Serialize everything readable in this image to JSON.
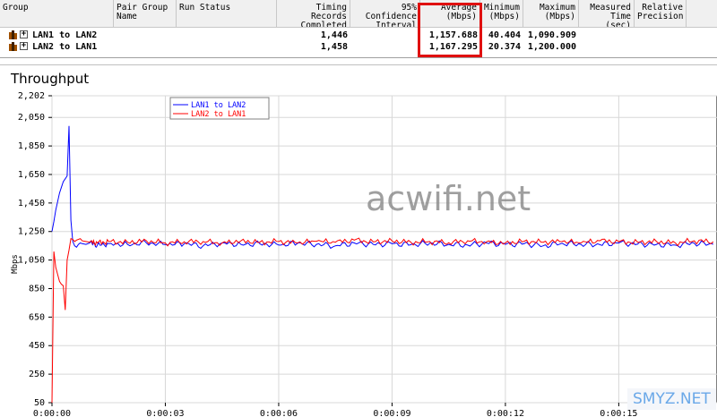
{
  "table": {
    "columns": [
      {
        "label": "Group",
        "align": "left"
      },
      {
        "label": "Pair Group\nName",
        "align": "left"
      },
      {
        "label": "Run Status",
        "align": "left"
      },
      {
        "label": "Timing Records\nCompleted",
        "align": "right"
      },
      {
        "label": "95% Confidence\nInterval",
        "align": "right"
      },
      {
        "label": "Average\n(Mbps)",
        "align": "right"
      },
      {
        "label": "Minimum\n(Mbps)",
        "align": "right"
      },
      {
        "label": "Maximum\n(Mbps)",
        "align": "right"
      },
      {
        "label": "Measured\nTime (sec)",
        "align": "right"
      },
      {
        "label": "Relative\nPrecision",
        "align": "right"
      }
    ],
    "rows": [
      {
        "group": "LAN1 to LAN2",
        "pair_group": "",
        "run_status": "",
        "timing_records": "1,446",
        "confidence": "",
        "average": "1,157.688",
        "minimum": "40.404",
        "maximum": "1,090.909",
        "measured_time": "",
        "precision": ""
      },
      {
        "group": "LAN2 to LAN1",
        "pair_group": "",
        "run_status": "",
        "timing_records": "1,458",
        "confidence": "",
        "average": "1,167.295",
        "minimum": "20.374",
        "maximum": "1,200.000",
        "measured_time": "",
        "precision": ""
      }
    ]
  },
  "graph": {
    "title": "Throughput",
    "watermark": "acwifi.net",
    "watermark2": "SMYZ.NET"
  },
  "chart_data": {
    "type": "line",
    "title": "Throughput",
    "xlabel": "",
    "ylabel": "Mbps",
    "ylim": [
      50,
      2202
    ],
    "xlim": [
      0,
      17.6
    ],
    "x_unit": "seconds (elapsed h:mm:ss)",
    "yticks": [
      "2,202",
      "2,050",
      "1,850",
      "1,650",
      "1,450",
      "1,250",
      "1,050",
      "850",
      "650",
      "450",
      "250",
      "50"
    ],
    "ytick_values": [
      2202,
      2050,
      1850,
      1650,
      1450,
      1250,
      1050,
      850,
      650,
      450,
      250,
      50
    ],
    "xticks": [
      "0:00:00",
      "0:00:03",
      "0:00:06",
      "0:00:09",
      "0:00:12",
      "0:00:15"
    ],
    "xtick_values": [
      0,
      3,
      6,
      9,
      12,
      15
    ],
    "grid": true,
    "legend_position": "top-left",
    "series": [
      {
        "name": "LAN1 to LAN2",
        "color": "#0000ff",
        "x": [
          0.0,
          0.05,
          0.1,
          0.15,
          0.2,
          0.25,
          0.3,
          0.35,
          0.4,
          0.45,
          0.5,
          0.55,
          0.6,
          0.65,
          0.7,
          0.75,
          0.8,
          0.9,
          1.0,
          1.2,
          1.5,
          2,
          2.5,
          3,
          3.5,
          4,
          4.5,
          5,
          5.5,
          6,
          6.5,
          7,
          7.5,
          8,
          8.5,
          9,
          9.5,
          10,
          10.5,
          11,
          11.5,
          12,
          12.5,
          13,
          13.5,
          14,
          14.5,
          15,
          15.5,
          16,
          16.5,
          17,
          17.5
        ],
        "y": [
          1250,
          1320,
          1400,
          1460,
          1520,
          1560,
          1600,
          1620,
          1640,
          1990,
          1330,
          1180,
          1150,
          1140,
          1160,
          1170,
          1165,
          1160,
          1170,
          1155,
          1165,
          1160,
          1170,
          1158,
          1165,
          1150,
          1170,
          1160,
          1165,
          1155,
          1168,
          1160,
          1150,
          1170,
          1160,
          1165,
          1158,
          1168,
          1160,
          1155,
          1170,
          1160,
          1165,
          1150,
          1168,
          1160,
          1158,
          1170,
          1162,
          1160,
          1155,
          1168,
          1160
        ]
      },
      {
        "name": "LAN2 to LAN1",
        "color": "#ff0000",
        "x": [
          0.0,
          0.05,
          0.1,
          0.15,
          0.2,
          0.25,
          0.3,
          0.35,
          0.4,
          0.45,
          0.5,
          0.55,
          0.6,
          0.65,
          0.7,
          0.75,
          0.8,
          0.9,
          1.0,
          1.2,
          1.5,
          2,
          2.5,
          3,
          3.5,
          4,
          4.5,
          5,
          5.5,
          6,
          6.5,
          7,
          7.5,
          8,
          8.5,
          9,
          9.5,
          10,
          10.5,
          11,
          11.5,
          12,
          12.5,
          13,
          13.5,
          14,
          14.5,
          15,
          15.5,
          16,
          16.5,
          17,
          17.5
        ],
        "y": [
          50,
          1110,
          1000,
          950,
          900,
          880,
          870,
          700,
          1050,
          1120,
          1200,
          1195,
          1180,
          1190,
          1195,
          1200,
          1185,
          1180,
          1175,
          1170,
          1180,
          1175,
          1185,
          1170,
          1178,
          1180,
          1170,
          1185,
          1175,
          1180,
          1170,
          1182,
          1175,
          1190,
          1178,
          1185,
          1175,
          1180,
          1172,
          1185,
          1178,
          1170,
          1182,
          1175,
          1180,
          1170,
          1185,
          1178,
          1175,
          1180,
          1170,
          1185,
          1178
        ]
      }
    ]
  }
}
